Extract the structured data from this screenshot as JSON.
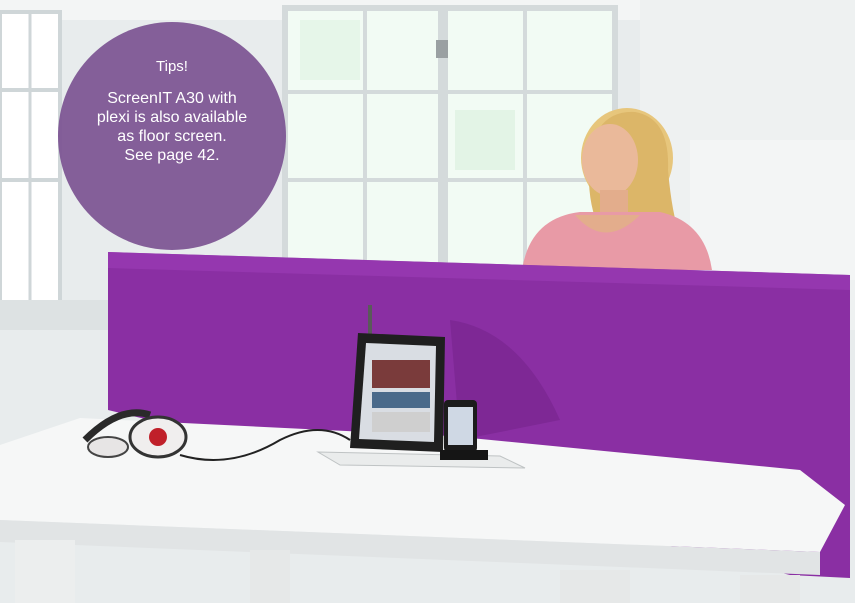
{
  "tip": {
    "title": "Tips!",
    "lines": [
      "ScreenIT A30 with",
      "plexi is also available",
      "as floor screen.",
      "See page 42."
    ]
  },
  "colors": {
    "screen_purple": "#8a2fa3",
    "tip_bubble": "#7c5492",
    "wall": "#e9edee",
    "desk": "#f5f6f6"
  },
  "icons": [
    "headphones-icon",
    "tablet-icon",
    "smartphone-icon"
  ]
}
